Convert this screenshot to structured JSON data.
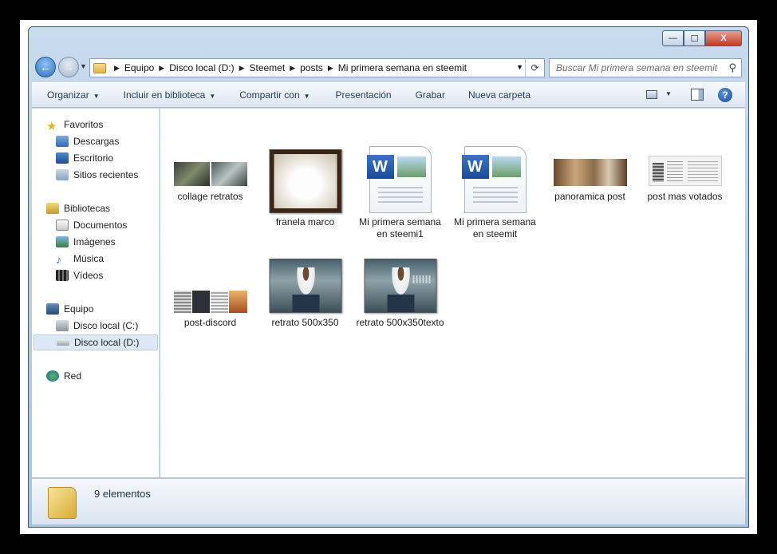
{
  "window": {
    "min_glyph": "—",
    "max_glyph": "☐",
    "close_glyph": "X"
  },
  "address": {
    "crumbs": [
      "Equipo",
      "Disco local (D:)",
      "Steemet",
      "posts",
      "Mi primera semana en steemit"
    ]
  },
  "search": {
    "placeholder": "Buscar Mi primera semana en steemit"
  },
  "toolbar": {
    "organizar": "Organizar",
    "incluir": "Incluir en biblioteca",
    "compartir": "Compartir con",
    "presentacion": "Presentación",
    "grabar": "Grabar",
    "nueva_carpeta": "Nueva carpeta"
  },
  "nav": {
    "favoritos": "Favoritos",
    "descargas": "Descargas",
    "escritorio": "Escritorio",
    "sitios": "Sitios recientes",
    "bibliotecas": "Bibliotecas",
    "documentos": "Documentos",
    "imagenes": "Imágenes",
    "musica": "Música",
    "videos": "Vídeos",
    "equipo": "Equipo",
    "disco_c": "Disco local (C:)",
    "disco_d": "Disco local (D:)",
    "red": "Red"
  },
  "files": [
    {
      "name": "collage retratos",
      "kind": "image"
    },
    {
      "name": "franela marco",
      "kind": "image"
    },
    {
      "name": "Mi primera semana en steemi1",
      "kind": "word-document"
    },
    {
      "name": "Mi primera semana en steemit",
      "kind": "word-document"
    },
    {
      "name": "panoramica post",
      "kind": "image"
    },
    {
      "name": "post mas votados",
      "kind": "image"
    },
    {
      "name": "post-discord",
      "kind": "image"
    },
    {
      "name": "retrato 500x350",
      "kind": "image"
    },
    {
      "name": "retrato 500x350texto",
      "kind": "image"
    }
  ],
  "status": {
    "count_text": "9 elementos"
  }
}
